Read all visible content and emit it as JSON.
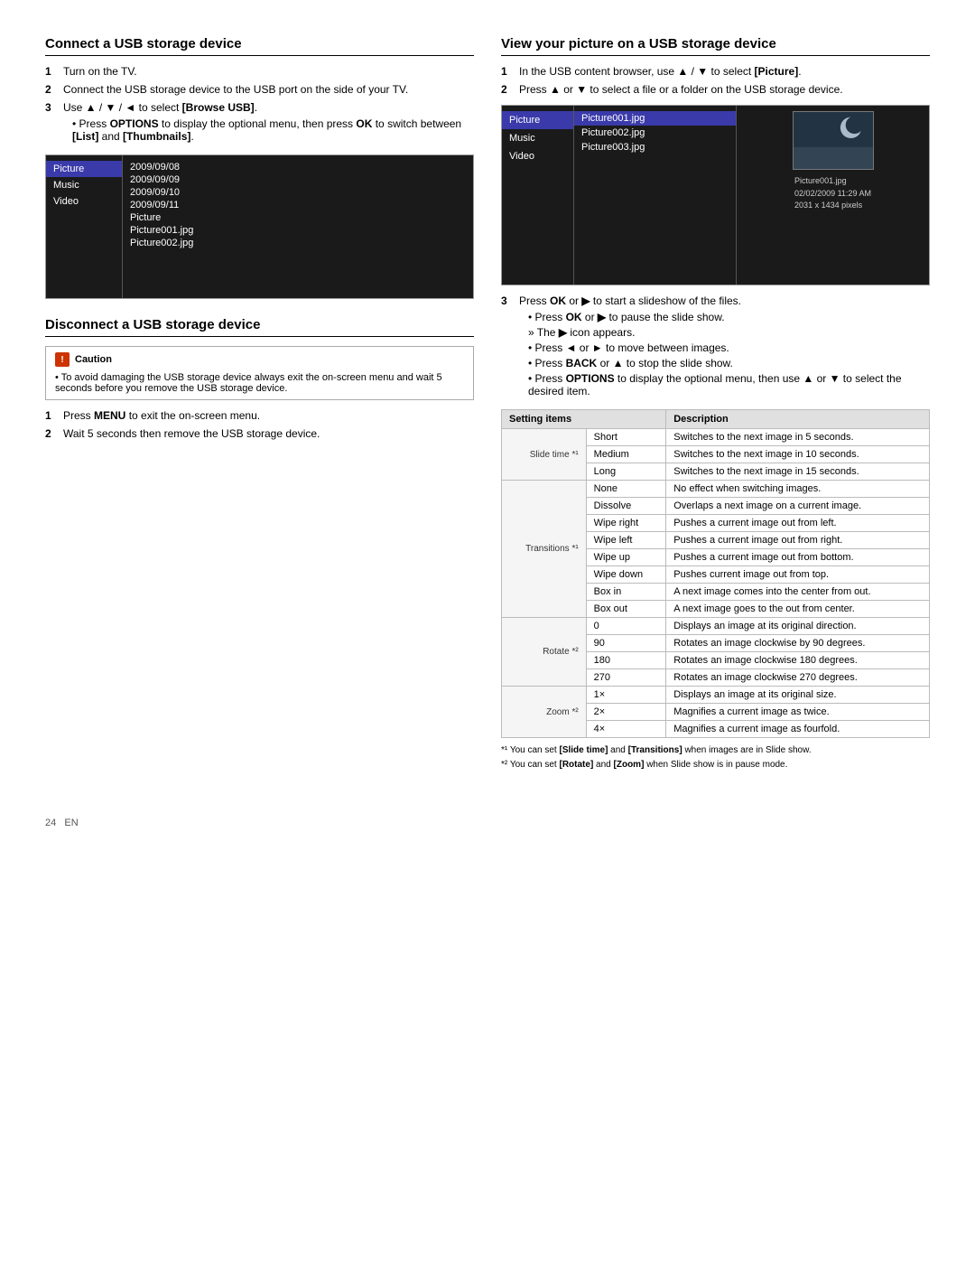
{
  "page": {
    "number": "24",
    "locale": "EN"
  },
  "connect_section": {
    "title": "Connect a USB storage device",
    "steps": [
      {
        "num": "1",
        "text": "Turn on the TV."
      },
      {
        "num": "2",
        "text": "Connect the USB storage device to the USB port on the side of your TV."
      },
      {
        "num": "3",
        "text": "Use ▲ / ▼ / ◄ to select [Browse USB].",
        "bullets": [
          "Press OPTIONS to display the optional menu, then press OK to switch between [List] and [Thumbnails]."
        ]
      }
    ],
    "browser": {
      "sidebar_items": [
        "Picture",
        "Music",
        "Video"
      ],
      "active_sidebar": "Picture",
      "files": [
        "2009/09/08",
        "2009/09/09",
        "2009/09/10",
        "2009/09/11",
        "Picture",
        "Picture001.jpg",
        "Picture002.jpg"
      ]
    }
  },
  "disconnect_section": {
    "title": "Disconnect a USB storage device",
    "caution_title": "Caution",
    "caution_body": "To avoid damaging the USB storage device always exit the on-screen menu and wait 5 seconds before you remove the USB storage device.",
    "steps": [
      {
        "num": "1",
        "text": "Press MENU to exit the on-screen menu."
      },
      {
        "num": "2",
        "text": "Wait 5 seconds then remove the USB storage device."
      }
    ]
  },
  "view_section": {
    "title": "View your picture on a USB storage device",
    "steps": [
      {
        "num": "1",
        "text": "In the USB content browser, use ▲ / ▼ to select [Picture]."
      },
      {
        "num": "2",
        "text": "Press ▲ or ▼ to select a file or a folder on the USB storage device."
      }
    ],
    "browser": {
      "sidebar_items": [
        "Picture",
        "Music",
        "Video"
      ],
      "files": [
        "Picture001.jpg",
        "Picture002.jpg",
        "Picture003.jpg"
      ],
      "active_file": "Picture001.jpg",
      "preview_info": [
        "Picture001.jpg",
        "02/02/2009 11:29 AM",
        "2031 x 1434 pixels"
      ]
    },
    "step3": {
      "num": "3",
      "text": "Press OK or ▶ to start a slideshow of the files.",
      "bullets": [
        "Press OK or ▶ to pause the slide show.",
        "The ▶ icon appears.",
        "Press ◄ or ► to move between images.",
        "Press BACK or ▲ to stop the slide show.",
        "Press OPTIONS to display the optional menu, then use ▲ or ▼ to select the desired item."
      ],
      "bullets_arrow": [
        "The ▶ icon appears."
      ]
    }
  },
  "settings_table": {
    "col1": "Setting items",
    "col2": "Description",
    "groups": [
      {
        "group_label": "Slide time *¹",
        "rows": [
          {
            "label": "Short",
            "desc": "Switches to the next image in 5 seconds."
          },
          {
            "label": "Medium",
            "desc": "Switches to the next image in 10 seconds."
          },
          {
            "label": "Long",
            "desc": "Switches to the next image in 15 seconds."
          }
        ]
      },
      {
        "group_label": "Transitions *¹",
        "rows": [
          {
            "label": "None",
            "desc": "No effect when switching images."
          },
          {
            "label": "Dissolve",
            "desc": "Overlaps a next image on a current image."
          },
          {
            "label": "Wipe right",
            "desc": "Pushes a current image out from left."
          },
          {
            "label": "Wipe left",
            "desc": "Pushes a current image out from right."
          },
          {
            "label": "Wipe up",
            "desc": "Pushes a current image out from bottom."
          },
          {
            "label": "Wipe down",
            "desc": "Pushes current image out from top."
          },
          {
            "label": "Box in",
            "desc": "A next image comes into the center from out."
          },
          {
            "label": "Box out",
            "desc": "A next image goes to the out from center."
          }
        ]
      },
      {
        "group_label": "Rotate *²",
        "rows": [
          {
            "label": "0",
            "desc": "Displays an image at its original direction."
          },
          {
            "label": "90",
            "desc": "Rotates an image clockwise by 90 degrees."
          },
          {
            "label": "180",
            "desc": "Rotates an image clockwise 180 degrees."
          },
          {
            "label": "270",
            "desc": "Rotates an image clockwise 270 degrees."
          }
        ]
      },
      {
        "group_label": "Zoom *²",
        "rows": [
          {
            "label": "1×",
            "desc": "Displays an image at its original size."
          },
          {
            "label": "2×",
            "desc": "Magnifies a current image as twice."
          },
          {
            "label": "4×",
            "desc": "Magnifies a current image as fourfold."
          }
        ]
      }
    ],
    "footnotes": [
      "*¹ You can set [Slide time] and [Transitions] when images are in Slide show.",
      "*² You can set [Rotate] and [Zoom] when Slide show is in pause mode."
    ]
  }
}
